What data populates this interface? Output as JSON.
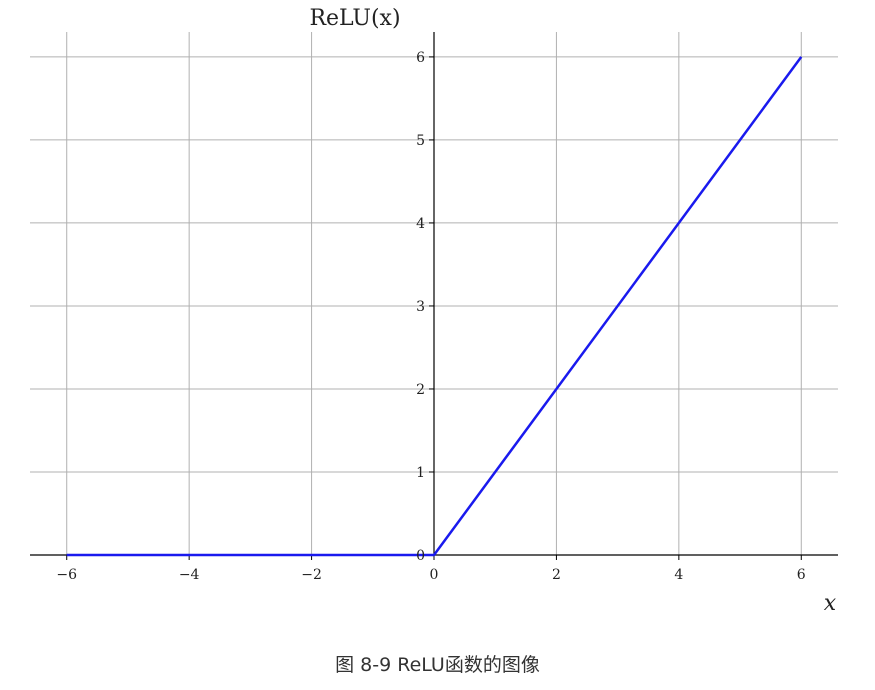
{
  "chart_data": {
    "type": "line",
    "xlabel": "x",
    "ylabel": "ReLU(x)",
    "xlim": [
      -6.6,
      6.6
    ],
    "ylim": [
      0,
      6.3
    ],
    "x_ticks": [
      -6,
      -4,
      -2,
      0,
      2,
      4,
      6
    ],
    "x_tick_labels": [
      "−6",
      "−4",
      "−2",
      "0",
      "2",
      "4",
      "6"
    ],
    "y_ticks": [
      0,
      1,
      2,
      3,
      4,
      5,
      6
    ],
    "y_tick_labels": [
      "0",
      "1",
      "2",
      "3",
      "4",
      "5",
      "6"
    ],
    "grid": true,
    "series": [
      {
        "color": "#1a1aee",
        "x": [
          -6,
          0,
          6
        ],
        "y": [
          0,
          0,
          6
        ]
      }
    ]
  },
  "caption": "图 8-9 ReLU函数的图像"
}
